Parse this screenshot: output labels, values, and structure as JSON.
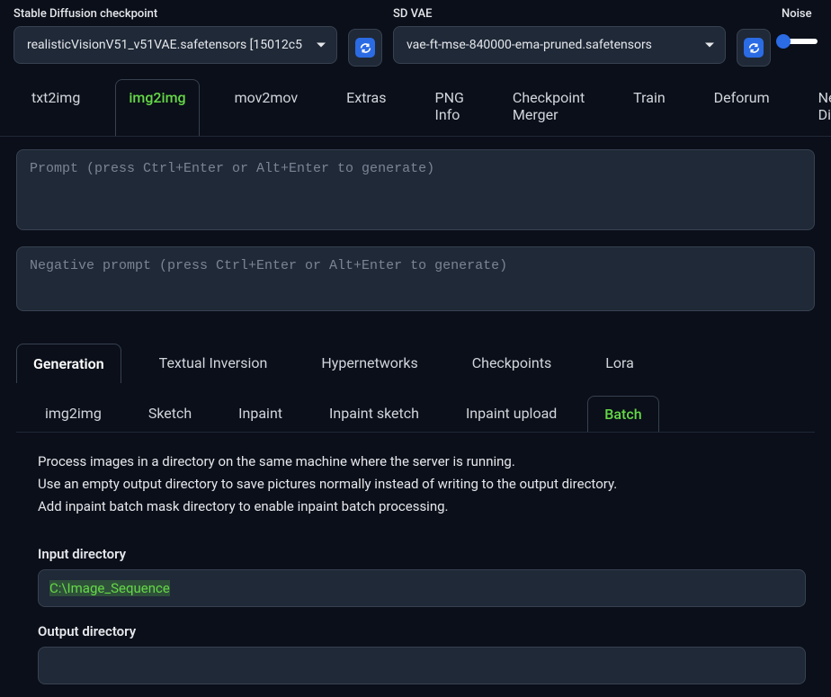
{
  "header": {
    "checkpoint_label": "Stable Diffusion checkpoint",
    "checkpoint_value": "realisticVisionV51_v51VAE.safetensors [15012c5",
    "vae_label": "SD VAE",
    "vae_value": "vae-ft-mse-840000-ema-pruned.safetensors",
    "noise_label": "Noise",
    "refresh_icon": "refresh-icon"
  },
  "main_tabs": [
    {
      "label": "txt2img"
    },
    {
      "label": "img2img",
      "active": true
    },
    {
      "label": "mov2mov"
    },
    {
      "label": "Extras"
    },
    {
      "label": "PNG Info"
    },
    {
      "label": "Checkpoint Merger"
    },
    {
      "label": "Train"
    },
    {
      "label": "Deforum"
    },
    {
      "label": "Next Diff"
    }
  ],
  "prompts": {
    "prompt_placeholder": "Prompt (press Ctrl+Enter or Alt+Enter to generate)",
    "negative_placeholder": "Negative prompt (press Ctrl+Enter or Alt+Enter to generate)",
    "prompt_value": "",
    "negative_value": ""
  },
  "sub_tabs": [
    {
      "label": "Generation",
      "active": true
    },
    {
      "label": "Textual Inversion"
    },
    {
      "label": "Hypernetworks"
    },
    {
      "label": "Checkpoints"
    },
    {
      "label": "Lora"
    }
  ],
  "mode_tabs": [
    {
      "label": "img2img"
    },
    {
      "label": "Sketch"
    },
    {
      "label": "Inpaint"
    },
    {
      "label": "Inpaint sketch"
    },
    {
      "label": "Inpaint upload"
    },
    {
      "label": "Batch",
      "active": true
    }
  ],
  "batch": {
    "info1": "Process images in a directory on the same machine where the server is running.",
    "info2": "Use an empty output directory to save pictures normally instead of writing to the output directory.",
    "info3": "Add inpaint batch mask directory to enable inpaint batch processing.",
    "input_label": "Input directory",
    "input_value": "C:\\Image_Sequence",
    "output_label": "Output directory",
    "output_value": ""
  }
}
